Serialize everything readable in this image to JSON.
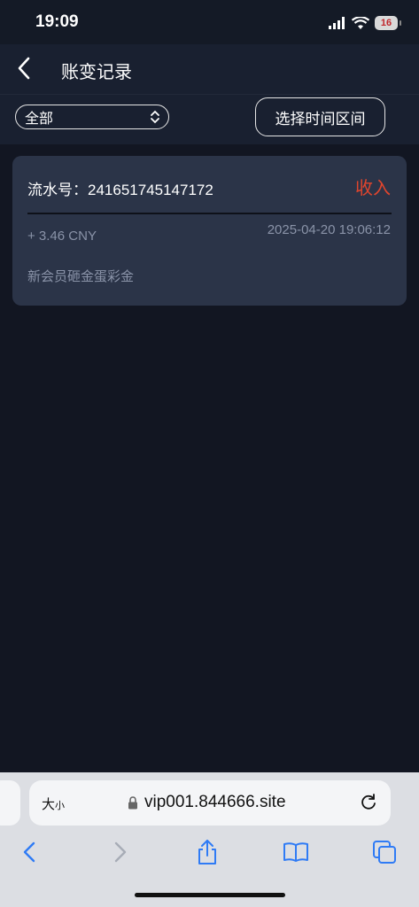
{
  "status_bar": {
    "time": "19:09",
    "battery": "16"
  },
  "nav": {
    "title": "账变记录"
  },
  "filter": {
    "select_value": "全部",
    "time_button_label": "选择时间区间"
  },
  "record": {
    "serial_label": "流水号：",
    "serial_number": "241651745147172",
    "type": "收入",
    "amount": "+ 3.46 CNY",
    "datetime": "2025-04-20 19:06:12",
    "description": "新会员砸金蛋彩金"
  },
  "browser": {
    "text_size_label": "大",
    "text_size_small": "小",
    "url": "vip001.844666.site"
  },
  "colors": {
    "background": "#121622",
    "card": "#2b3448",
    "income": "#e0452d",
    "muted_text": "#8a93a8",
    "accent": "#2f7bf5"
  },
  "icons": [
    "back-icon",
    "chevron-up-down-icon",
    "lock-icon",
    "reload-icon",
    "share-icon",
    "bookmarks-icon",
    "tabs-icon",
    "forward-icon"
  ]
}
